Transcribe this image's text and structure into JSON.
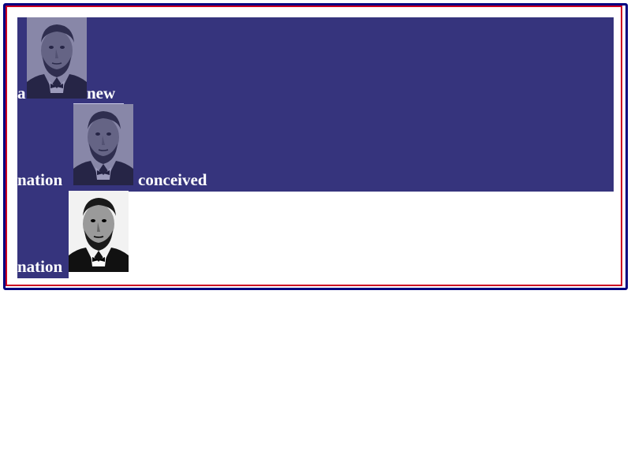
{
  "words": {
    "w1": "a",
    "w2": "new",
    "w3": "nation",
    "w4": "conceived",
    "w5": "nation"
  },
  "portrait": {
    "icon": "lincoln-portrait",
    "colors": {
      "frame_outer": "#000080",
      "frame_inner": "#cc0022",
      "highlight": "#36347d",
      "text": "#ffffff"
    }
  }
}
